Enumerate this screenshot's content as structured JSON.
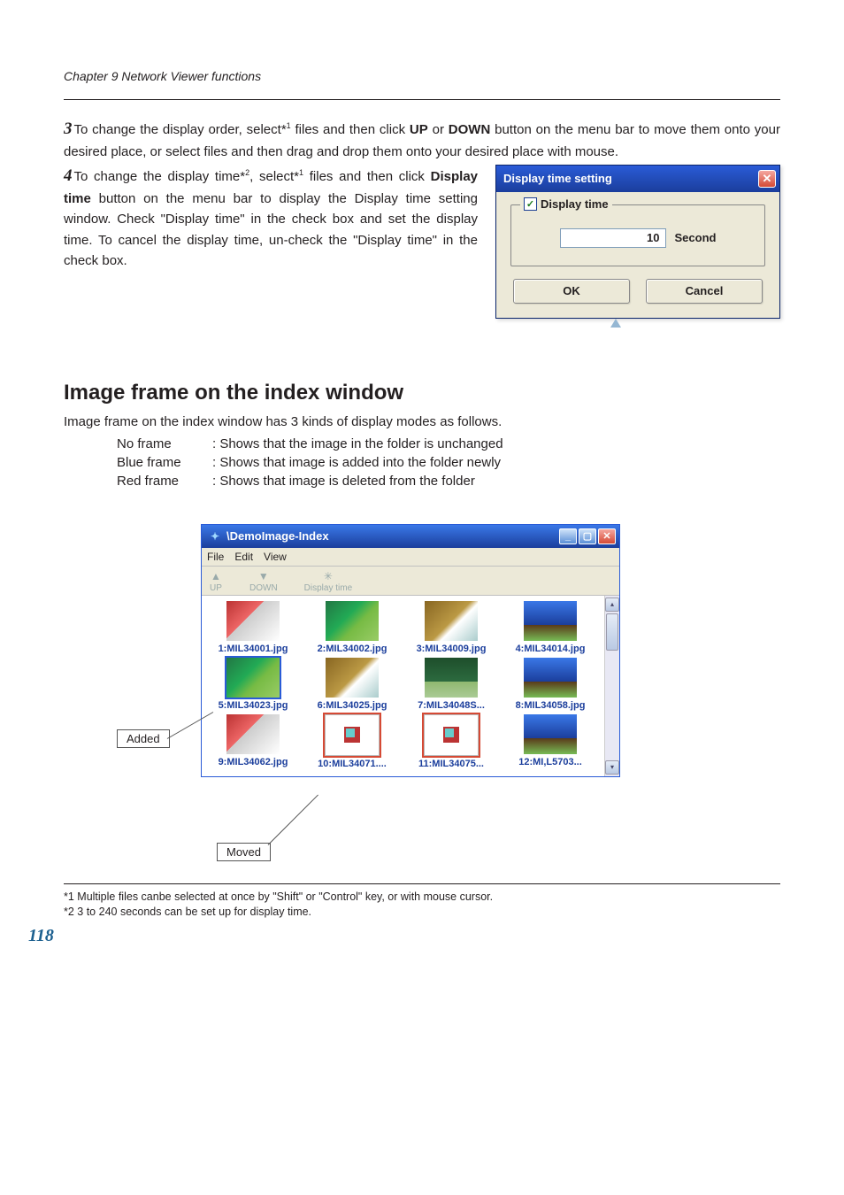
{
  "chapter_header": "Chapter 9 Network Viewer functions",
  "step3": {
    "num": "3",
    "text_a": "To change the display order, select*",
    "sup1": "1",
    "text_b": " files and then click ",
    "bold_up": "UP",
    "text_c": " or ",
    "bold_down": "DOWN",
    "text_d": " button on the menu bar to move them onto your desired place, or select files and then drag and drop them onto your desired place with mouse."
  },
  "step4": {
    "num": "4",
    "text_a": "To change the display time*",
    "sup2": "2",
    "text_b": ", select*",
    "sup1": "1",
    "text_c": " files and then click ",
    "bold_dt": "Display time",
    "text_d": " button on the menu bar to display the Display time setting window. Check \"Display time\" in the check box and set the display time. To cancel the display time, un-check the \"Display time\" in the check box."
  },
  "dialog": {
    "title": "Display time setting",
    "checkbox_label": "Display time",
    "value": "10",
    "unit": "Second",
    "ok": "OK",
    "cancel": "Cancel"
  },
  "section_heading": "Image frame on the index window",
  "section_intro": "Image frame on the index window has 3 kinds of display modes as follows.",
  "frame_modes": [
    {
      "label": "No frame",
      "desc": ": Shows that the image in the folder is unchanged"
    },
    {
      "label": "Blue frame",
      "desc": ": Shows that image is added into the folder newly"
    },
    {
      "label": "Red frame",
      "desc": ": Shows that image is deleted from the folder"
    }
  ],
  "index_window": {
    "title": "\\DemoImage-Index",
    "menu": [
      "File",
      "Edit",
      "View"
    ],
    "toolbar": [
      "UP",
      "DOWN",
      "Display time"
    ],
    "thumbs": [
      "1:MIL34001.jpg",
      "2:MIL34002.jpg",
      "3:MIL34009.jpg",
      "4:MIL34014.jpg",
      "5:MIL34023.jpg",
      "6:MIL34025.jpg",
      "7:MIL34048S...",
      "8:MIL34058.jpg",
      "9:MIL34062.jpg",
      "10:MIL34071....",
      "11:MIL34075...",
      "12:MI,L5703..."
    ]
  },
  "callouts": {
    "added": "Added",
    "moved": "Moved"
  },
  "footnotes": {
    "f1": "*1 Multiple files canbe selected at once by \"Shift\" or \"Control\" key, or with mouse cursor.",
    "f2": "*2 3 to 240 seconds can be set up for display time."
  },
  "page_number": "118"
}
